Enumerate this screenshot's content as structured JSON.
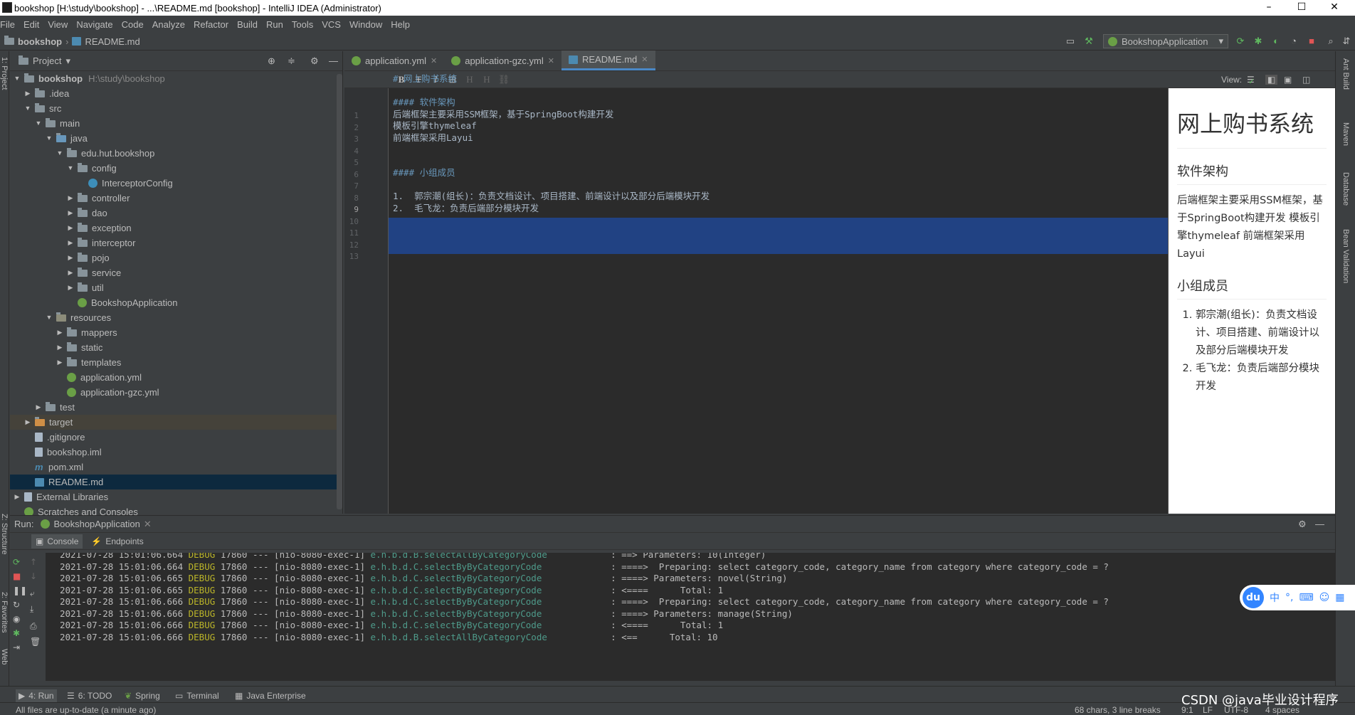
{
  "window": {
    "title": "bookshop [H:\\study\\bookshop] - ...\\README.md [bookshop] - IntelliJ IDEA (Administrator)",
    "min": "–",
    "max": "☐",
    "close": "✕"
  },
  "menu": [
    "File",
    "Edit",
    "View",
    "Navigate",
    "Code",
    "Analyze",
    "Refactor",
    "Build",
    "Run",
    "Tools",
    "VCS",
    "Window",
    "Help"
  ],
  "breadcrumb": {
    "project": "bookshop",
    "file": "README.md"
  },
  "run_config": "BookshopApplication",
  "left_strip": {
    "project": "1: Project",
    "structure": "Z: Structure",
    "favorites": "2: Favorites",
    "web": "Web"
  },
  "right_strip": {
    "ant": "Ant Build",
    "maven": "Maven",
    "database": "Database",
    "bean": "Bean Validation"
  },
  "project_panel": {
    "title": "Project",
    "tree": [
      {
        "label": "bookshop",
        "extra": "H:\\study\\bookshop",
        "depth": 0,
        "icon": "folder",
        "arrow": "down"
      },
      {
        "label": ".idea",
        "depth": 1,
        "icon": "folder",
        "arrow": "right"
      },
      {
        "label": "src",
        "depth": 1,
        "icon": "folder",
        "arrow": "down"
      },
      {
        "label": "main",
        "depth": 2,
        "icon": "folder",
        "arrow": "down"
      },
      {
        "label": "java",
        "depth": 3,
        "icon": "folder-blue",
        "arrow": "down"
      },
      {
        "label": "edu.hut.bookshop",
        "depth": 4,
        "icon": "folder",
        "arrow": "down"
      },
      {
        "label": "config",
        "depth": 5,
        "icon": "folder",
        "arrow": "down"
      },
      {
        "label": "InterceptorConfig",
        "depth": 6,
        "icon": "class",
        "arrow": ""
      },
      {
        "label": "controller",
        "depth": 5,
        "icon": "folder",
        "arrow": "right"
      },
      {
        "label": "dao",
        "depth": 5,
        "icon": "folder",
        "arrow": "right"
      },
      {
        "label": "exception",
        "depth": 5,
        "icon": "folder",
        "arrow": "right"
      },
      {
        "label": "interceptor",
        "depth": 5,
        "icon": "folder",
        "arrow": "right"
      },
      {
        "label": "pojo",
        "depth": 5,
        "icon": "folder",
        "arrow": "right"
      },
      {
        "label": "service",
        "depth": 5,
        "icon": "folder",
        "arrow": "right"
      },
      {
        "label": "util",
        "depth": 5,
        "icon": "folder",
        "arrow": "right"
      },
      {
        "label": "BookshopApplication",
        "depth": 5,
        "icon": "spring",
        "arrow": ""
      },
      {
        "label": "resources",
        "depth": 3,
        "icon": "folder-res",
        "arrow": "down"
      },
      {
        "label": "mappers",
        "depth": 4,
        "icon": "folder",
        "arrow": "right"
      },
      {
        "label": "static",
        "depth": 4,
        "icon": "folder",
        "arrow": "right"
      },
      {
        "label": "templates",
        "depth": 4,
        "icon": "folder",
        "arrow": "right"
      },
      {
        "label": "application.yml",
        "depth": 4,
        "icon": "spring",
        "arrow": ""
      },
      {
        "label": "application-gzc.yml",
        "depth": 4,
        "icon": "spring",
        "arrow": ""
      },
      {
        "label": "test",
        "depth": 2,
        "icon": "folder",
        "arrow": "right"
      },
      {
        "label": "target",
        "depth": 1,
        "icon": "folder-orange",
        "arrow": "right"
      },
      {
        "label": ".gitignore",
        "depth": 1,
        "icon": "file",
        "arrow": ""
      },
      {
        "label": "bookshop.iml",
        "depth": 1,
        "icon": "file",
        "arrow": ""
      },
      {
        "label": "pom.xml",
        "depth": 1,
        "icon": "maven",
        "arrow": ""
      },
      {
        "label": "README.md",
        "depth": 1,
        "icon": "md",
        "arrow": ""
      },
      {
        "label": "External Libraries",
        "depth": 0,
        "icon": "lib",
        "arrow": "right"
      },
      {
        "label": "Scratches and Consoles",
        "depth": 0,
        "icon": "scratch",
        "arrow": ""
      }
    ]
  },
  "editor": {
    "tabs": [
      {
        "label": "application.yml",
        "active": false
      },
      {
        "label": "application-gzc.yml",
        "active": false
      },
      {
        "label": "README.md",
        "active": true
      }
    ],
    "toolbar_view": "View:",
    "lines": [
      "# 网上购书系统",
      "",
      "#### 软件架构",
      "后端框架主要采用SSM框架，基于SpringBoot构建开发",
      "模板引擎thymeleaf",
      "前端框架采用Layui",
      "",
      "",
      "#### 小组成员",
      "",
      "1.  郭宗潮(组长)：负责文档设计、项目搭建、前端设计以及部分后端模块开发",
      "2.  毛飞龙：负责后端部分模块开发",
      ""
    ],
    "preview": {
      "h1": "网上购书系统",
      "h2a": "软件架构",
      "p": "后端框架主要采用SSM框架，基于SpringBoot构建开发 模板引擎thymeleaf 前端框架采用Layui",
      "h2b": "小组成员",
      "li1": "郭宗潮(组长)：负责文档设计、项目搭建、前端设计以及部分后端模块开发",
      "li2": "毛飞龙：负责后端部分模块开发"
    }
  },
  "run_panel": {
    "label": "Run:",
    "config": "BookshopApplication",
    "tabs": [
      "Console",
      "Endpoints"
    ],
    "logs": [
      {
        "ts": "2021-07-28 15:01:06.664",
        "lvl": "DEBUG",
        "pid": "17860 --- [nio-8080-exec-1]",
        "cls": "e.h.b.d.B.selectAllByCategoryCode",
        "msg": ": ==> Parameters: 10(Integer)"
      },
      {
        "ts": "2021-07-28 15:01:06.664",
        "lvl": "DEBUG",
        "pid": "17860 --- [nio-8080-exec-1]",
        "cls": "e.h.b.d.C.selectByByCategoryCode",
        "msg": ": ====>  Preparing: select category_code, category_name from category where category_code = ?"
      },
      {
        "ts": "2021-07-28 15:01:06.665",
        "lvl": "DEBUG",
        "pid": "17860 --- [nio-8080-exec-1]",
        "cls": "e.h.b.d.C.selectByByCategoryCode",
        "msg": ": ====> Parameters: novel(String)"
      },
      {
        "ts": "2021-07-28 15:01:06.665",
        "lvl": "DEBUG",
        "pid": "17860 --- [nio-8080-exec-1]",
        "cls": "e.h.b.d.C.selectByByCategoryCode",
        "msg": ": <====      Total: 1"
      },
      {
        "ts": "2021-07-28 15:01:06.666",
        "lvl": "DEBUG",
        "pid": "17860 --- [nio-8080-exec-1]",
        "cls": "e.h.b.d.C.selectByByCategoryCode",
        "msg": ": ====>  Preparing: select category_code, category_name from category where category_code = ?"
      },
      {
        "ts": "2021-07-28 15:01:06.666",
        "lvl": "DEBUG",
        "pid": "17860 --- [nio-8080-exec-1]",
        "cls": "e.h.b.d.C.selectByByCategoryCode",
        "msg": ": ====> Parameters: manage(String)"
      },
      {
        "ts": "2021-07-28 15:01:06.666",
        "lvl": "DEBUG",
        "pid": "17860 --- [nio-8080-exec-1]",
        "cls": "e.h.b.d.C.selectByByCategoryCode",
        "msg": ": <====      Total: 1"
      },
      {
        "ts": "2021-07-28 15:01:06.666",
        "lvl": "DEBUG",
        "pid": "17860 --- [nio-8080-exec-1]",
        "cls": "e.h.b.d.B.selectAllByCategoryCode",
        "msg": ": <==      Total: 10"
      }
    ]
  },
  "bottom_tools": [
    "4: Run",
    "6: TODO",
    "Spring",
    "Terminal",
    "Java Enterprise"
  ],
  "status": {
    "left": "All files are up-to-date (a minute ago)",
    "chars": "68 chars, 3 line breaks",
    "pos": "9:1",
    "lf": "LF",
    "enc": "UTF-8",
    "indent": "4 spaces"
  },
  "watermark": "CSDN @java毕业设计程序",
  "ime": {
    "logo": "du",
    "lang": "中"
  },
  "colors": {
    "selection": "#214283",
    "bg_editor": "#2b2b2b",
    "bg_panel": "#3c3f41",
    "accent": "#4a88c7"
  }
}
